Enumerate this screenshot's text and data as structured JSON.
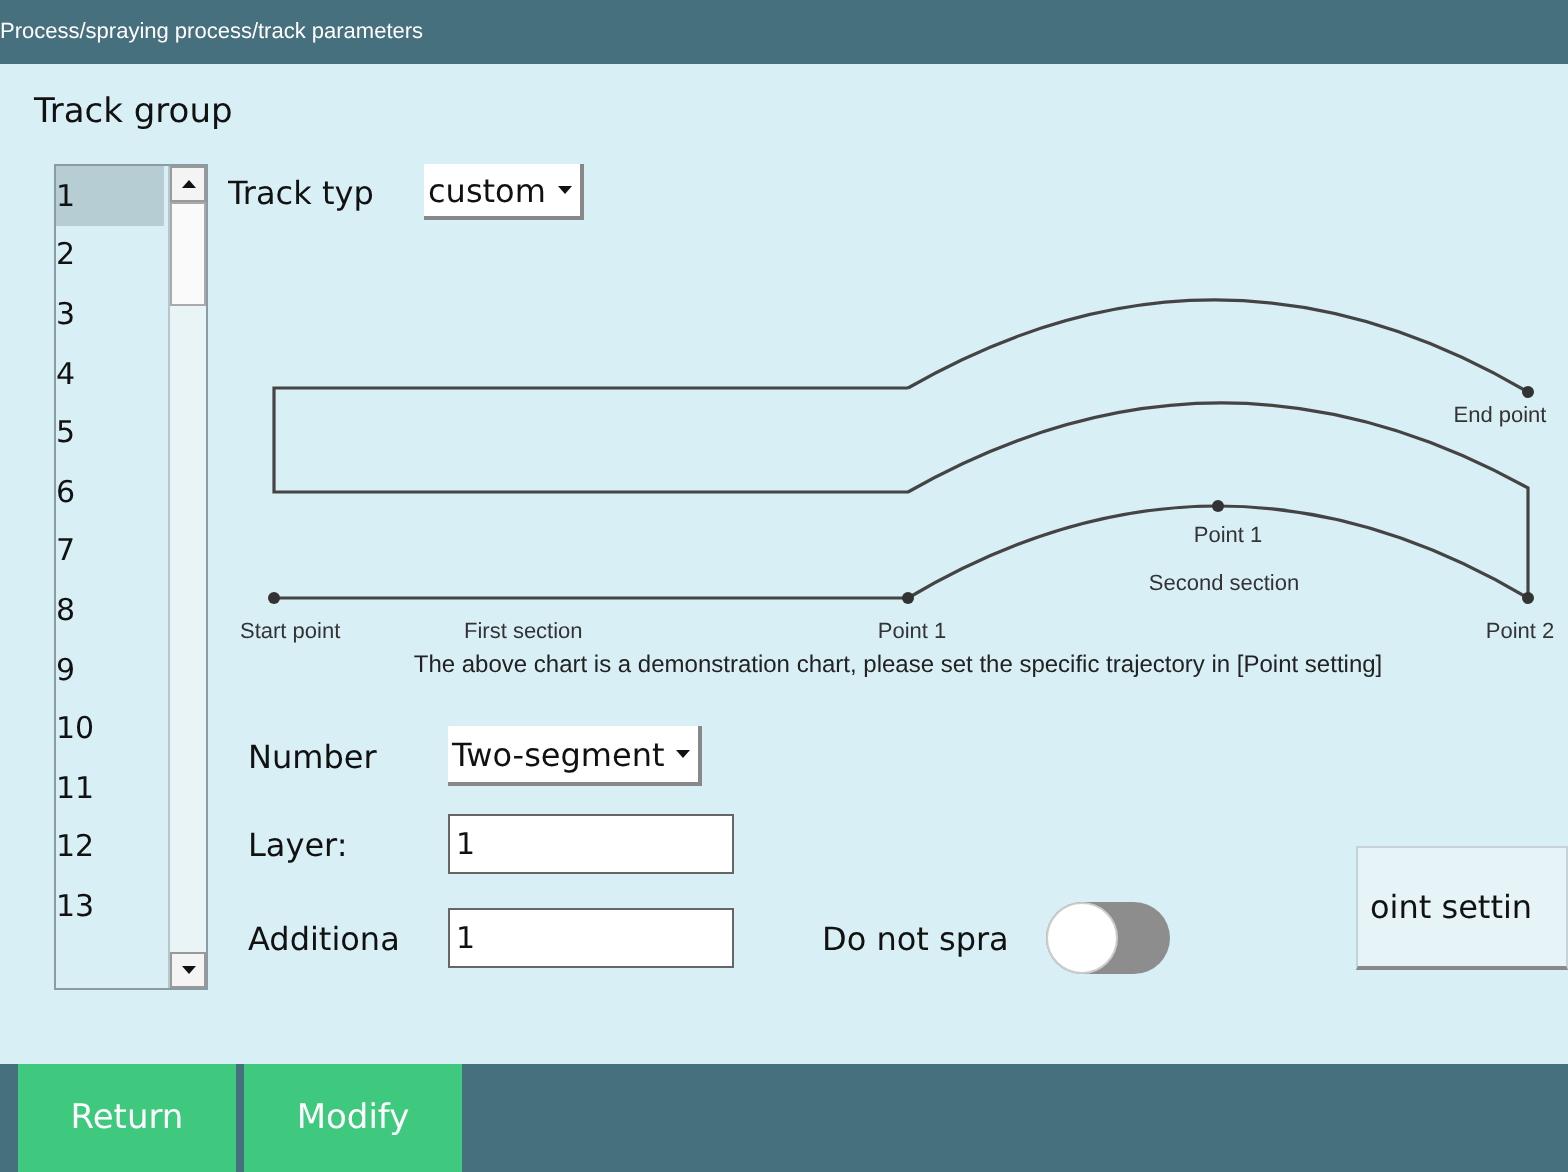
{
  "breadcrumb": "Process/spraying process/track parameters",
  "section_title": "Track group",
  "track_list": [
    {
      "label": "1",
      "selected": true
    },
    {
      "label": "2",
      "selected": false
    },
    {
      "label": "3",
      "selected": false
    },
    {
      "label": "4",
      "selected": false
    },
    {
      "label": "5",
      "selected": false
    },
    {
      "label": "6",
      "selected": false
    },
    {
      "label": "7",
      "selected": false
    },
    {
      "label": "8",
      "selected": false
    },
    {
      "label": "9",
      "selected": false
    },
    {
      "label": "10",
      "selected": false
    },
    {
      "label": "11",
      "selected": false
    },
    {
      "label": "12",
      "selected": false
    },
    {
      "label": "13",
      "selected": false
    }
  ],
  "track_type": {
    "label": "Track typ",
    "value": "custom"
  },
  "diagram": {
    "labels": [
      "End point",
      "Point 1",
      "Second section",
      "Start point",
      "First section",
      "Point 1",
      "Point 2"
    ],
    "caption": "The above chart is a demonstration chart, please set the specific trajectory in [Point setting]"
  },
  "segments": {
    "label": "Number",
    "value": "Two-segment"
  },
  "layer": {
    "label": "Layer:",
    "value": "1"
  },
  "additional": {
    "label": "Additiona",
    "value": "1"
  },
  "do_not_spray": {
    "label": "Do not spra",
    "on": false
  },
  "point_setting_button": "oint settin",
  "footer_buttons": [
    "Return",
    "Modify"
  ]
}
